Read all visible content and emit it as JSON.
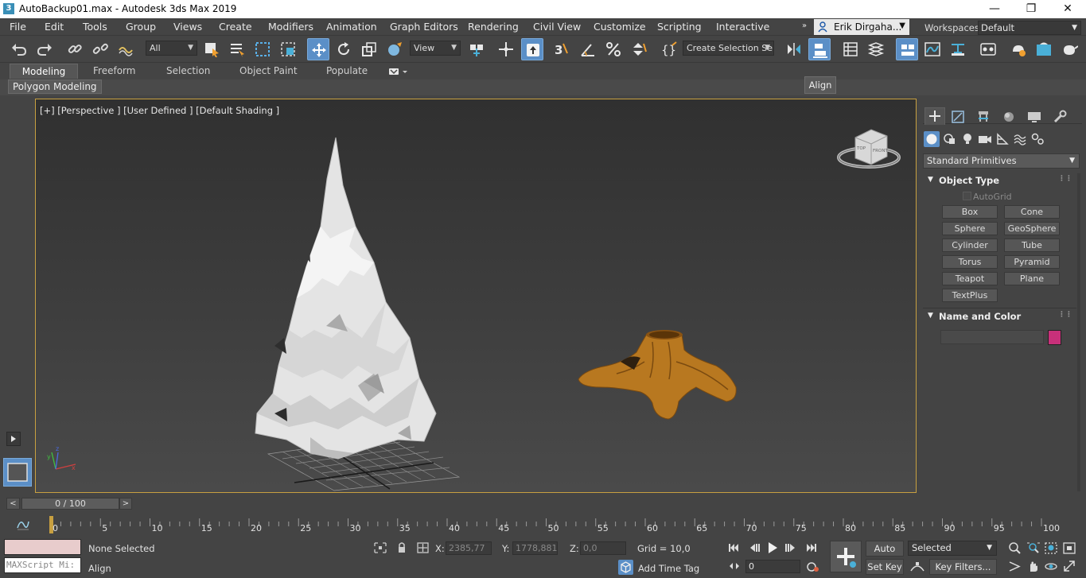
{
  "window": {
    "title": "AutoBackup01.max - Autodesk 3ds Max 2019",
    "app_icon": "3",
    "controls": [
      "minimize-icon",
      "restore-icon",
      "close-icon"
    ]
  },
  "menu": {
    "items": [
      "File",
      "Edit",
      "Tools",
      "Group",
      "Views",
      "Create",
      "Modifiers",
      "Animation",
      "Graph Editors",
      "Rendering",
      "Civil View",
      "Customize",
      "Scripting",
      "Interactive"
    ],
    "overflow": "»",
    "user": "Erik Dirgaha...",
    "workspaces_label": "Workspaces:",
    "workspace_value": "Default"
  },
  "toolbar": {
    "selection_filter": "All",
    "reference_coord": "View",
    "named_selection": "Create Selection Se",
    "tooltip": "Align"
  },
  "ribbon": {
    "tabs": [
      "Modeling",
      "Freeform",
      "Selection",
      "Object Paint",
      "Populate"
    ],
    "active_tab": "Modeling",
    "panel_label": "Polygon Modeling"
  },
  "viewport": {
    "label": "[+] [Perspective ] [User Defined ] [Default Shading ]",
    "viewcube_top": "TOP",
    "viewcube_front": "FRONT",
    "axis_x": "x",
    "axis_y": "y",
    "axis_z": "z"
  },
  "command_panel": {
    "category": "Standard Primitives",
    "object_type_title": "Object Type",
    "autogrid": "AutoGrid",
    "buttons": [
      "Box",
      "Cone",
      "Sphere",
      "GeoSphere",
      "Cylinder",
      "Tube",
      "Torus",
      "Pyramid",
      "Teapot",
      "Plane",
      "TextPlus"
    ],
    "name_color_title": "Name and Color",
    "object_color": "#c8307a"
  },
  "timeline": {
    "slider": "0 / 100",
    "prev": "<",
    "next": ">",
    "ticks": [
      "0",
      "5",
      "10",
      "15",
      "20",
      "25",
      "30",
      "35",
      "40",
      "45",
      "50",
      "55",
      "60",
      "65",
      "70",
      "75",
      "80",
      "85",
      "90",
      "95",
      "100"
    ]
  },
  "status": {
    "maxscript": "MAXScript Mi:",
    "selection": "None Selected",
    "prompt": "Align",
    "x_label": "X:",
    "x_value": "2385,77",
    "y_label": "Y:",
    "y_value": "1778,881",
    "z_label": "Z:",
    "z_value": "0,0",
    "grid": "Grid = 10,0",
    "add_time_tag": "Add Time Tag",
    "auto_key": "Auto Key",
    "set_key": "Set Key",
    "key_mode": "Selected",
    "key_filters": "Key Filters...",
    "frame": "0"
  }
}
